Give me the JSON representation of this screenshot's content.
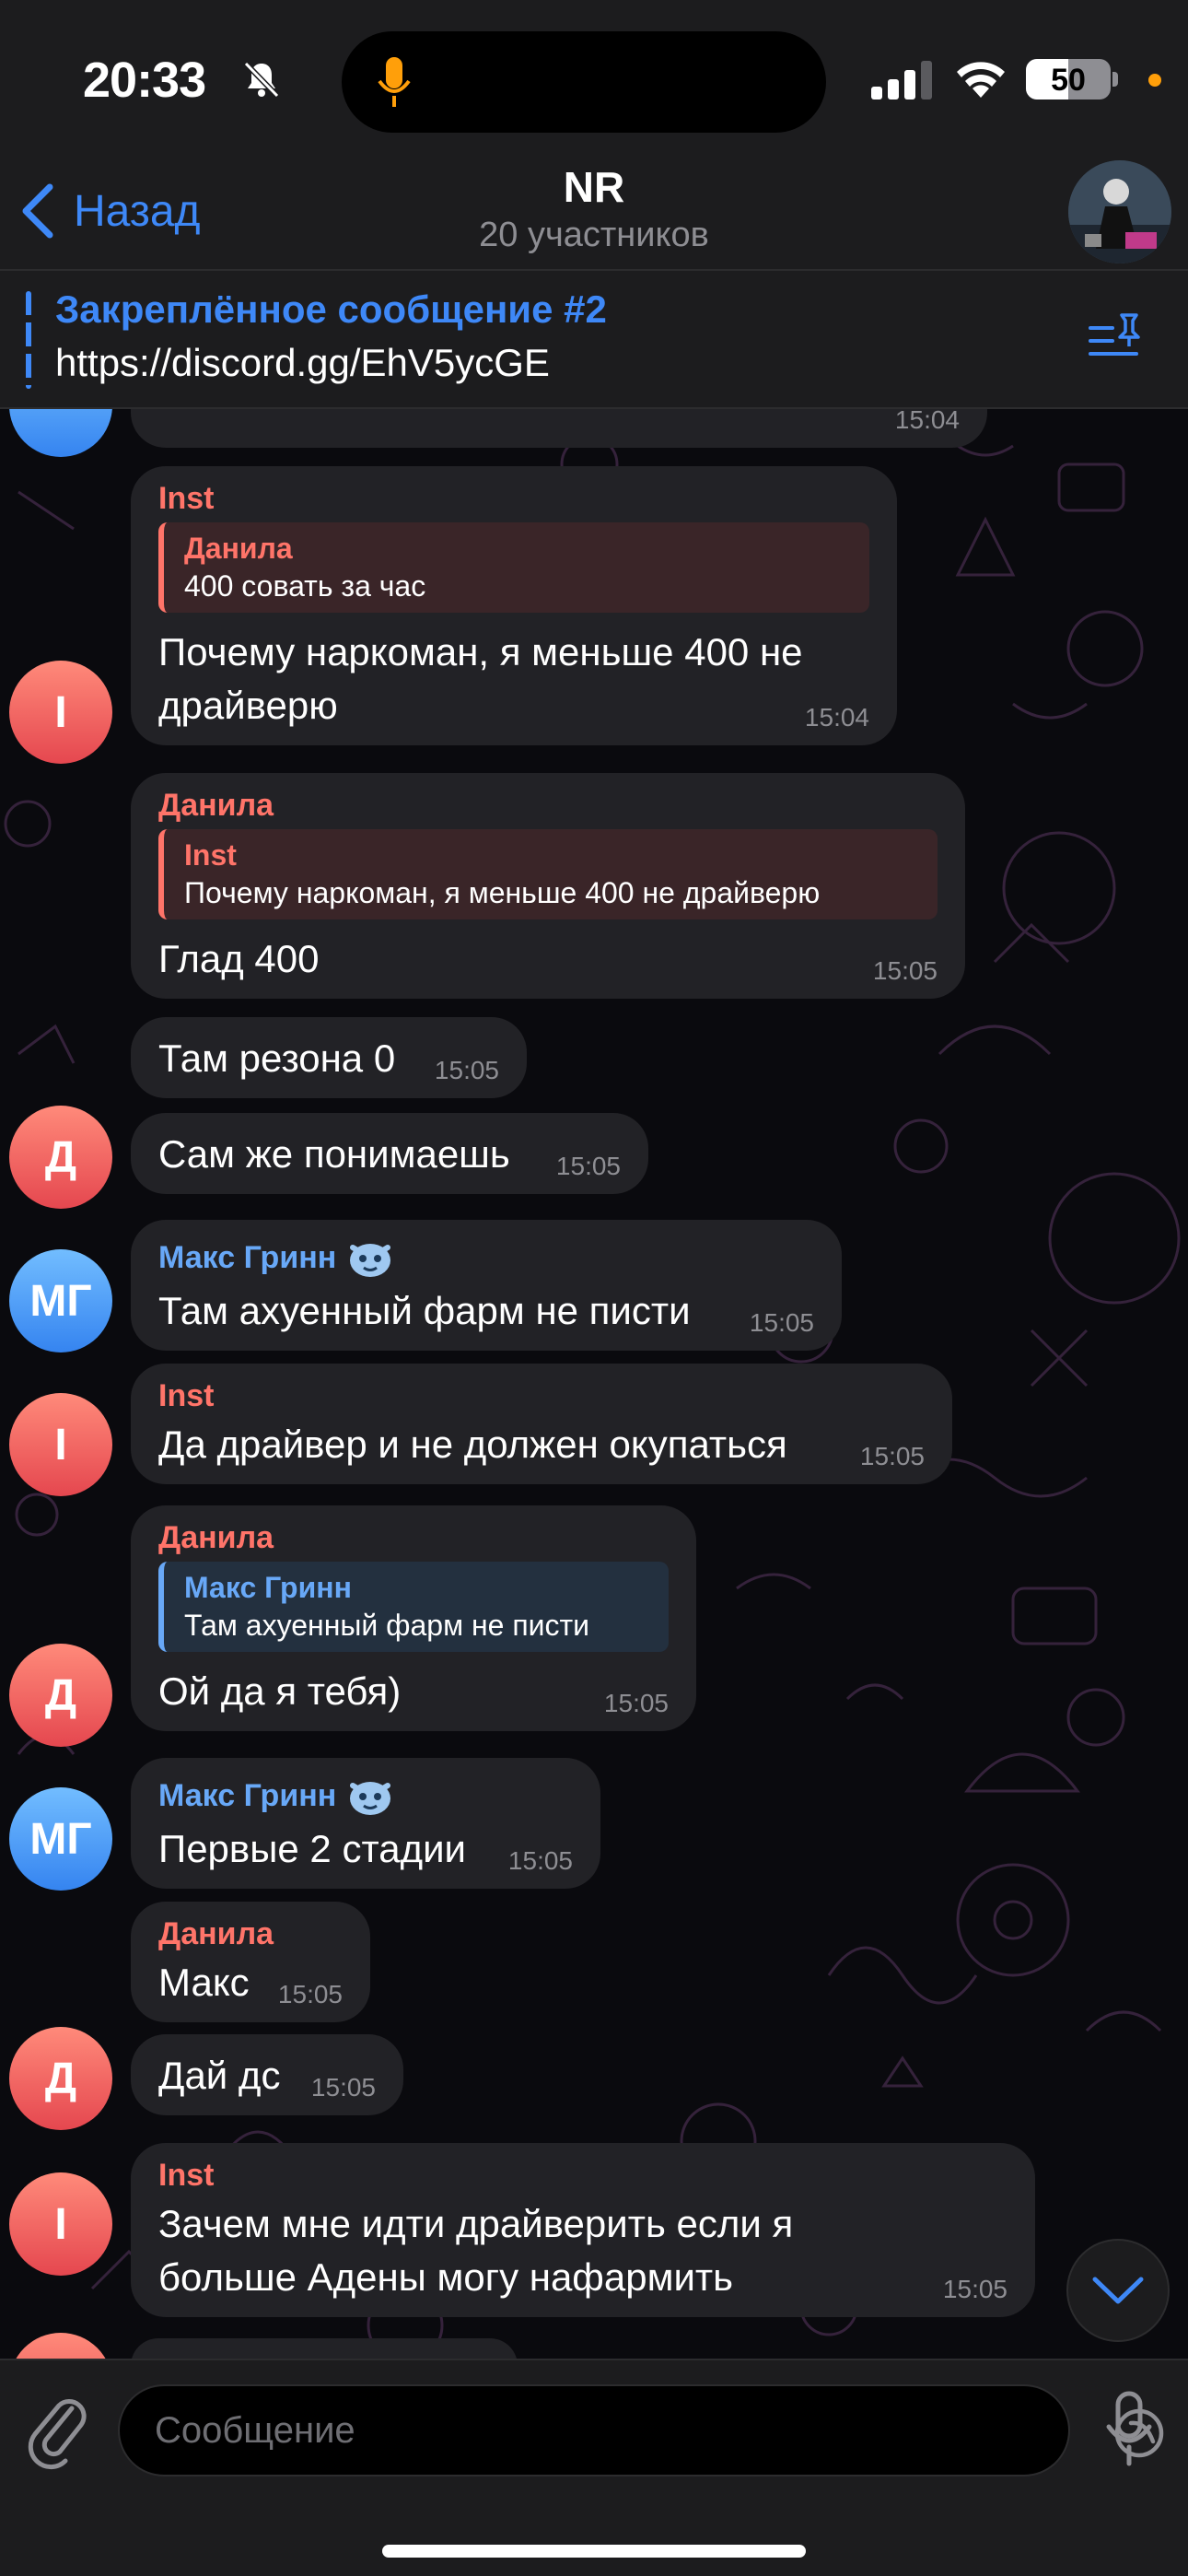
{
  "status": {
    "time": "20:33",
    "battery": "50",
    "battery_level": 0.5
  },
  "nav": {
    "back": "Назад",
    "title": "NR",
    "subtitle": "20 участников"
  },
  "pinned": {
    "title": "Закреплённое сообщение #2",
    "text": "https://discord.gg/EhV5ycGE"
  },
  "colors": {
    "accent": "#3e88f7",
    "name_red": "#ff7469",
    "name_blue": "#68a8f7",
    "bubble": "#222226"
  },
  "messages": [
    {
      "time": "15:04"
    },
    {
      "sender": "Inst",
      "reply_name": "Данила",
      "reply_text": "400 совать за час",
      "text": "Почему наркоман, я меньше 400 не драйверю",
      "time": "15:04",
      "avatar": "I"
    },
    {
      "sender": "Данила",
      "reply_name": "Inst",
      "reply_text": "Почему наркоман, я меньше 400 не драйверю",
      "text": "Глад 400",
      "time": "15:05"
    },
    {
      "text": "Там резона 0",
      "time": "15:05"
    },
    {
      "text": "Сам же понимаешь",
      "time": "15:05",
      "avatar": "Д"
    },
    {
      "sender": "Макс Гринн",
      "text": "Там ахуенный фарм не писти",
      "time": "15:05",
      "avatar": "МГ"
    },
    {
      "sender": "Inst",
      "text": "Да драйвер и не должен окупаться",
      "time": "15:05",
      "avatar": "I"
    },
    {
      "sender": "Данила",
      "reply_name": "Макс Гринн",
      "reply_text": "Там ахуенный фарм не писти",
      "text": "Ой да я тебя)",
      "time": "15:05",
      "avatar": "Д"
    },
    {
      "sender": "Макс Гринн",
      "text": "Первые 2 стадии",
      "time": "15:05",
      "avatar": "МГ"
    },
    {
      "sender": "Данила",
      "text": "Макс",
      "time": "15:05"
    },
    {
      "text": "Дай дс",
      "time": "15:05",
      "avatar": "Д"
    },
    {
      "sender": "Inst",
      "text": "Зачем мне идти драйверить если я больше Адены могу нафармить",
      "time": "15:05",
      "avatar": "I"
    }
  ],
  "composer": {
    "placeholder": "Сообщение"
  }
}
